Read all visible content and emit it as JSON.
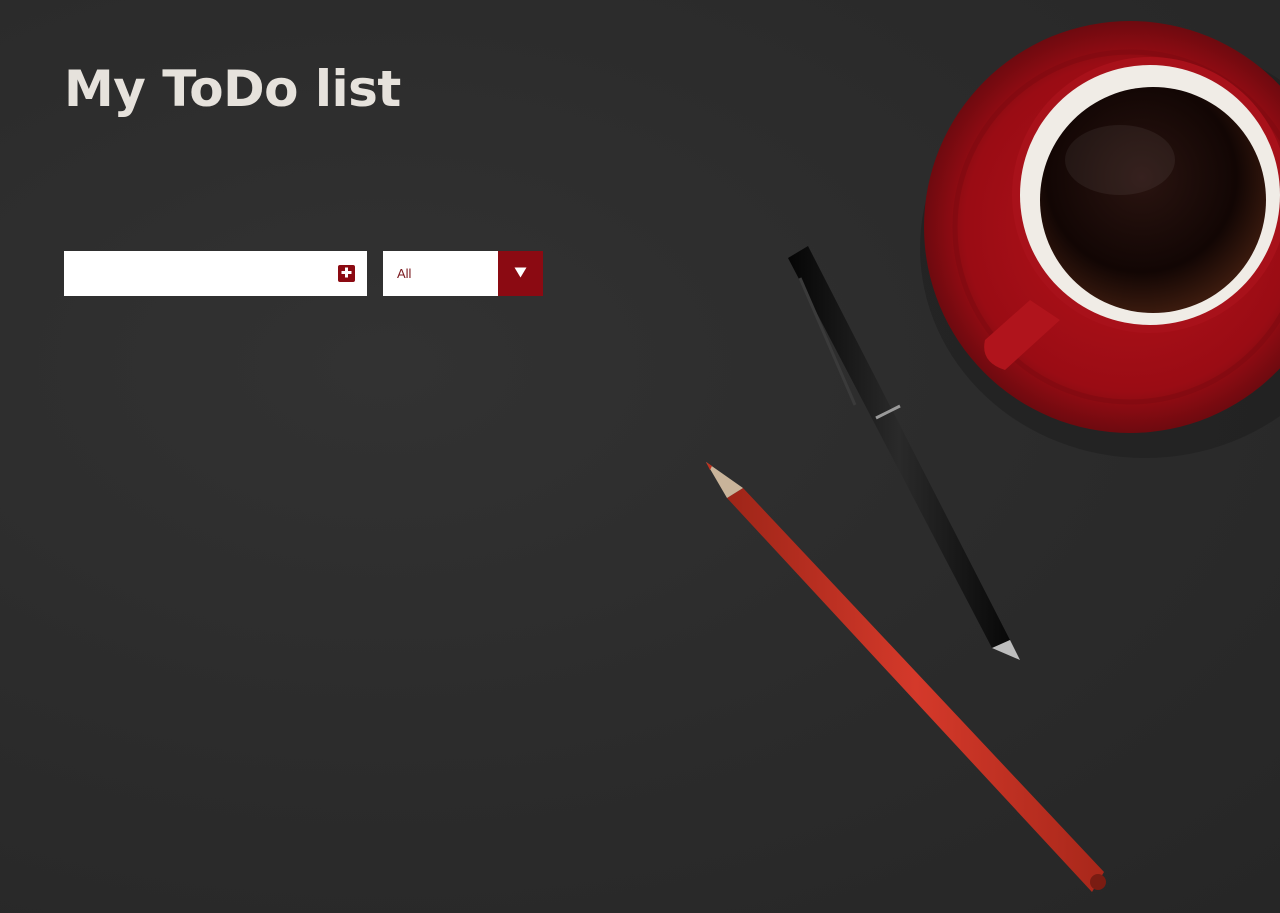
{
  "app": {
    "title": "My ToDo list"
  },
  "todo_input": {
    "value": "",
    "placeholder": "",
    "add_icon": "plus-square-icon"
  },
  "filter": {
    "selected": "All",
    "arrow_icon": "triangle-down-icon"
  },
  "colors": {
    "background": "#2c2c2c",
    "accent": "#8b0a12",
    "title": "#e6e2dc"
  }
}
